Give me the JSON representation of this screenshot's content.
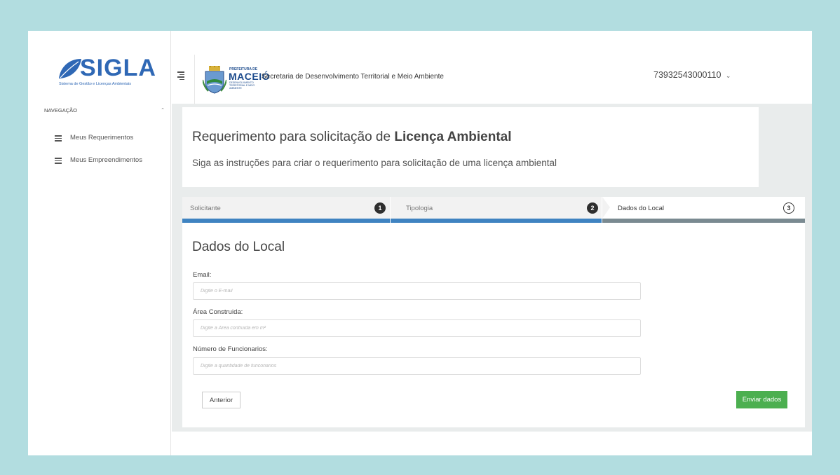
{
  "brand": {
    "logo_text": "SIGLA",
    "logo_subtitle": "Sistema de Gestão e Licenças Ambientais"
  },
  "header": {
    "prefeitura_small": "PREFEITURA DE",
    "prefeitura_big": "MACEIÓ",
    "prefeitura_tiny": "DESENVOLVIMENTO TERRITORIAL E MEIO AMBIENTE",
    "secretaria": "Secretaria de Desenvolvimento Territorial e Meio Ambiente",
    "user": "73932543000110"
  },
  "sidebar": {
    "heading": "NAVEGAÇÃO",
    "items": [
      {
        "label": "Meus Requerimentos"
      },
      {
        "label": "Meus Empreendimentos"
      }
    ]
  },
  "page": {
    "title_prefix": "Requerimento para solicitação de ",
    "title_bold": "Licença Ambiental",
    "subtitle": "Siga as instruções para criar o requerimento para solicitação de uma licença ambiental"
  },
  "wizard": {
    "steps": [
      {
        "label": "Solicitante",
        "number": "1",
        "state": "done"
      },
      {
        "label": "Tipologia",
        "number": "2",
        "state": "done"
      },
      {
        "label": "Dados do Local",
        "number": "3",
        "state": "active"
      }
    ],
    "form_title": "Dados do Local",
    "fields": [
      {
        "label": "Email:",
        "placeholder": "Digite o E-mail"
      },
      {
        "label": "Área Construida:",
        "placeholder": "Digite a Área contruida em m²"
      },
      {
        "label": "Número de Funcionarios:",
        "placeholder": "Digite a quantidade de funconarios"
      }
    ],
    "prev_label": "Anterior",
    "submit_label": "Enviar dados"
  },
  "colors": {
    "background": "#b2dde0",
    "brand_blue": "#2f68b5",
    "step_done": "#3f83c1",
    "step_active": "#7a8a91",
    "submit_green": "#4caf50"
  }
}
